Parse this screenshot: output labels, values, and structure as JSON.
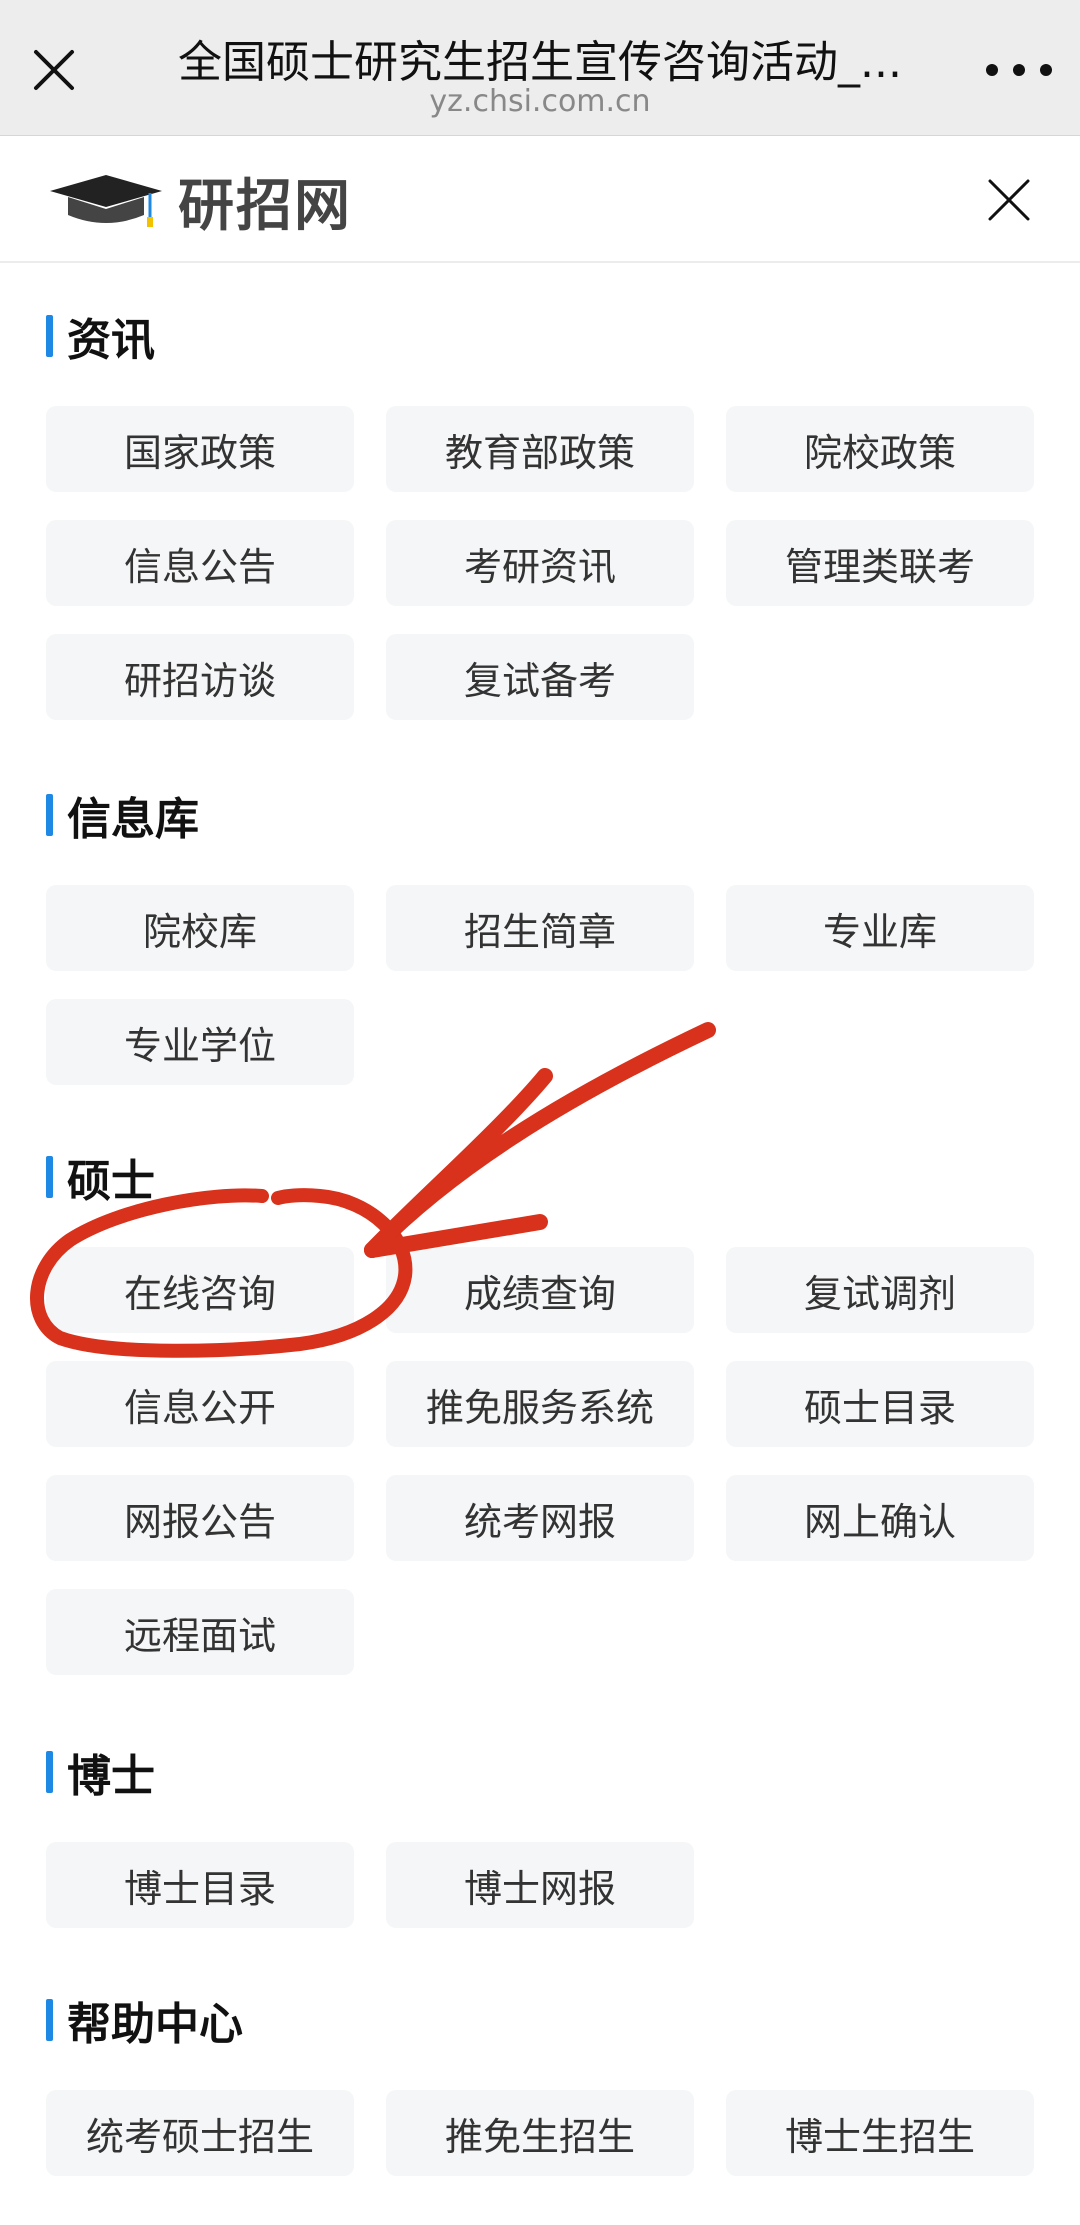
{
  "browser": {
    "title": "全国硕士研究生招生宣传咨询活动_...",
    "url": "yz.chsi.com.cn"
  },
  "site": {
    "logo_text": "研招网"
  },
  "sections": [
    {
      "title": "资讯",
      "items": [
        "国家政策",
        "教育部政策",
        "院校政策",
        "信息公告",
        "考研资讯",
        "管理类联考",
        "研招访谈",
        "复试备考"
      ]
    },
    {
      "title": "信息库",
      "items": [
        "院校库",
        "招生简章",
        "专业库",
        "专业学位"
      ]
    },
    {
      "title": "硕士",
      "items": [
        "在线咨询",
        "成绩查询",
        "复试调剂",
        "信息公开",
        "推免服务系统",
        "硕士目录",
        "网报公告",
        "统考网报",
        "网上确认",
        "远程面试"
      ]
    },
    {
      "title": "博士",
      "items": [
        "博士目录",
        "博士网报"
      ]
    },
    {
      "title": "帮助中心",
      "items": [
        "统考硕士招生",
        "推免生招生",
        "博士生招生"
      ]
    }
  ],
  "colors": {
    "accent": "#1e88e5",
    "annotation": "#d8321c",
    "button_bg": "#f5f6f7"
  },
  "icons": [
    "close-icon",
    "more-icon",
    "graduation-cap-icon",
    "menu-close-icon"
  ]
}
